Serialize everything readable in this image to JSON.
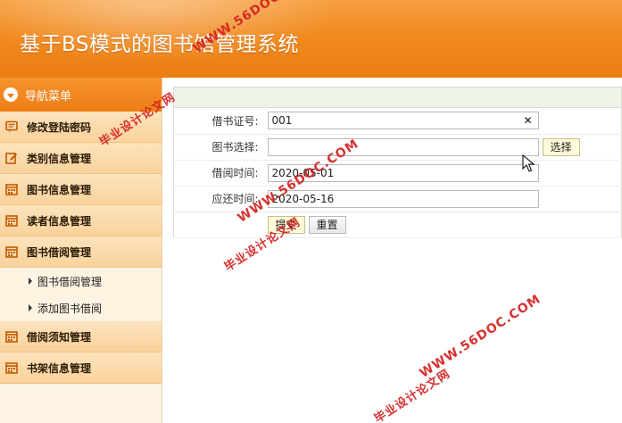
{
  "header": {
    "title": "基于BS模式的图书馆管理系统"
  },
  "sidebar": {
    "nav_label": "导航菜单",
    "items": [
      {
        "label": "修改登陆密码",
        "icon": "comment-icon"
      },
      {
        "label": "类别信息管理",
        "icon": "edit-icon"
      },
      {
        "label": "图书信息管理",
        "icon": "calendar-icon"
      },
      {
        "label": "读者信息管理",
        "icon": "calendar-icon"
      },
      {
        "label": "图书借阅管理",
        "icon": "calendar-icon"
      }
    ],
    "sub_items": [
      {
        "label": "图书借阅管理"
      },
      {
        "label": "添加图书借阅"
      }
    ],
    "items_after": [
      {
        "label": "借阅须知管理",
        "icon": "calendar-icon"
      },
      {
        "label": "书架信息管理",
        "icon": "calendar-icon"
      }
    ]
  },
  "form": {
    "card_no": {
      "label": "借书证号:",
      "value": "001"
    },
    "book_select": {
      "label": "图书选择:",
      "value": "",
      "button": "选择"
    },
    "borrow_time": {
      "label": "借阅时间:",
      "value": "2020-05-01"
    },
    "return_time": {
      "label": "应还时间:",
      "value": "2020-05-16"
    },
    "submit_label": "提交",
    "reset_label": "重置"
  },
  "watermarks": {
    "url": "WWW.56DOC.COM",
    "cn": "毕业设计论文网"
  },
  "colors": {
    "brand_orange": "#f08a1f",
    "sidebar_bg": "#fdf4e6",
    "watermark_red": "#d42020"
  }
}
